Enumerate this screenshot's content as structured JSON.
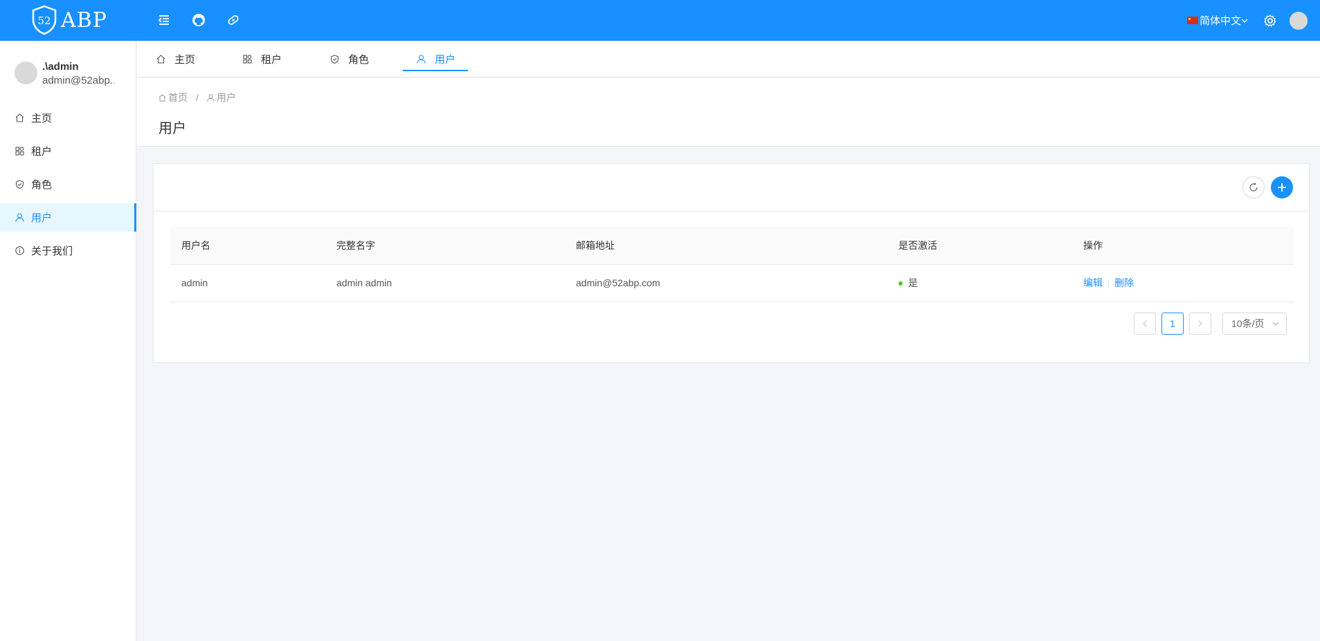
{
  "header": {
    "logo_text": "ABP",
    "logo_badge": "52",
    "language": "简体中文"
  },
  "sidebar": {
    "user_name": ".\\admin",
    "user_email": "admin@52abp...",
    "items": [
      {
        "label": "主页",
        "icon": "home-icon"
      },
      {
        "label": "租户",
        "icon": "appstore-icon"
      },
      {
        "label": "角色",
        "icon": "safety-icon"
      },
      {
        "label": "用户",
        "icon": "user-icon",
        "active": true
      },
      {
        "label": "关于我们",
        "icon": "info-icon"
      }
    ]
  },
  "tabs": [
    {
      "label": "主页",
      "icon": "home-icon"
    },
    {
      "label": "租户",
      "icon": "appstore-icon"
    },
    {
      "label": "角色",
      "icon": "safety-icon"
    },
    {
      "label": "用户",
      "icon": "user-icon",
      "active": true
    }
  ],
  "breadcrumb": {
    "home": "首页",
    "separator": "/",
    "current": "用户"
  },
  "page": {
    "title": "用户"
  },
  "table": {
    "columns": [
      "用户名",
      "完整名字",
      "邮箱地址",
      "是否激活",
      "操作"
    ],
    "rows": [
      {
        "username": "admin",
        "full_name": "admin admin",
        "email": "admin@52abp.com",
        "active": "是",
        "edit": "编辑",
        "delete": "删除"
      }
    ]
  },
  "pagination": {
    "current_page": "1",
    "page_size": "10条/页"
  },
  "colors": {
    "primary": "#1890ff",
    "success": "#52c41a"
  }
}
